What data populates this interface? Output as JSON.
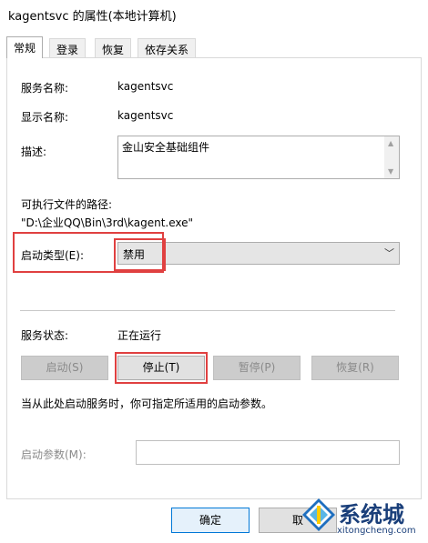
{
  "window": {
    "title": "kagentsvc 的属性(本地计算机)"
  },
  "tabs": [
    {
      "label": "常规"
    },
    {
      "label": "登录"
    },
    {
      "label": "恢复"
    },
    {
      "label": "依存关系"
    }
  ],
  "general": {
    "service_name_label": "服务名称:",
    "service_name_value": "kagentsvc",
    "display_name_label": "显示名称:",
    "display_name_value": "kagentsvc",
    "description_label": "描述:",
    "description_value": "金山安全基础组件",
    "exe_path_label": "可执行文件的路径:",
    "exe_path_value": "\"D:\\企业QQ\\Bin\\3rd\\kagent.exe\"",
    "startup_type_label": "启动类型(E):",
    "startup_type_value": "禁用",
    "service_status_label": "服务状态:",
    "service_status_value": "正在运行",
    "buttons": {
      "start": "启动(S)",
      "stop": "停止(T)",
      "pause": "暂停(P)",
      "resume": "恢复(R)"
    },
    "hint_text": "当从此处启动服务时，你可指定所适用的启动参数。",
    "start_params_label": "启动参数(M):",
    "start_params_value": ""
  },
  "footer": {
    "ok_label": "确定",
    "cancel_label": "取"
  },
  "watermark": {
    "brand": "系统城",
    "url": "xitongcheng.com"
  },
  "colors": {
    "highlight_red": "#e04040",
    "primary_border": "#0078d7"
  }
}
